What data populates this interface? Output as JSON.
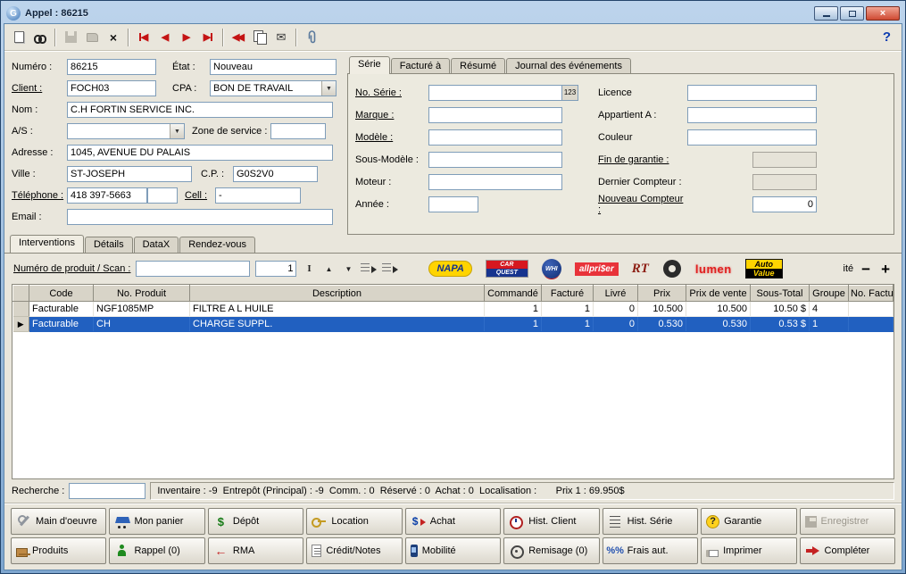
{
  "window": {
    "title": "Appel : 86215"
  },
  "toolbar": {
    "help": "?"
  },
  "form": {
    "numero_label": "Numéro :",
    "numero_value": "86215",
    "etat_label": "État :",
    "etat_value": "Nouveau",
    "client_label": "Client :",
    "client_value": "FOCH03",
    "cpa_label": "CPA :",
    "cpa_value": "BON DE TRAVAIL",
    "nom_label": "Nom :",
    "nom_value": "C.H FORTIN SERVICE INC.",
    "as_label": "A/S :",
    "as_value": "",
    "zone_label": "Zone de service :",
    "zone_value": "",
    "adresse_label": "Adresse :",
    "adresse_value": "1045, AVENUE DU PALAIS",
    "ville_label": "Ville :",
    "ville_value": "ST-JOSEPH",
    "cp_label": "C.P. :",
    "cp_value": "G0S2V0",
    "tel_label": "Téléphone :",
    "tel_value": "418 397-5663",
    "tel_ext_value": "",
    "cell_label": "Cell :",
    "cell_value": "-",
    "email_label": "Email :",
    "email_value": ""
  },
  "serie_panel": {
    "tabs": [
      "Série",
      "Facturé à",
      "Résumé",
      "Journal des événements"
    ],
    "no_serie_label": "No. Série :",
    "no_serie_value": "",
    "badge_123": "123",
    "licence_label": "Licence",
    "licence_value": "",
    "marque_label": "Marque :",
    "marque_value": "",
    "appartient_label": "Appartient A :",
    "appartient_value": "",
    "modele_label": "Modèle :",
    "modele_value": "",
    "couleur_label": "Couleur",
    "couleur_value": "",
    "sousmodele_label": "Sous-Modèle :",
    "sousmodele_value": "",
    "fingarantie_label": "Fin de garantie :",
    "fingarantie_value": "",
    "moteur_label": "Moteur :",
    "moteur_value": "",
    "dernier_label": "Dernier Compteur :",
    "dernier_value": "",
    "annee_label": "Année :",
    "annee_value": "",
    "nouveau_label": "Nouveau Compteur :",
    "nouveau_value": "0"
  },
  "main_tabs": [
    "Interventions",
    "Détails",
    "DataX",
    "Rendez-vous"
  ],
  "scan": {
    "label": "Numéro de produit / Scan :",
    "scan_value": "",
    "qty_value": "1",
    "qty_suffix": "ité",
    "minus": "−",
    "plus": "+"
  },
  "brands": {
    "napa": "NAPA",
    "carquest_top": "CAR",
    "carquest_bottom": "QUEST",
    "whi": "WHI",
    "allpriser": "allpri$er",
    "rt": "RT",
    "lumen": "lumen",
    "autovalue_top": "Auto",
    "autovalue_bottom": "Value"
  },
  "table": {
    "columns": [
      "",
      "Code",
      "No. Produit",
      "Description",
      "Commandé",
      "Facturé",
      "Livré",
      "Prix",
      "Prix de vente",
      "Sous-Total",
      "Groupe",
      "No. Facture"
    ],
    "rows": [
      {
        "marker": "",
        "code": "Facturable",
        "no_produit": "NGF1085MP",
        "description": "FILTRE A L HUILE",
        "commande": "1",
        "facture": "1",
        "livre": "0",
        "prix": "10.500",
        "prix_vente": "10.500",
        "sous_total": "10.50 $",
        "groupe": "4",
        "no_facture": ""
      },
      {
        "marker": "▶",
        "code": "Facturable",
        "no_produit": "CH",
        "description": "CHARGE SUPPL.",
        "commande": "1",
        "facture": "1",
        "livre": "0",
        "prix": "0.530",
        "prix_vente": "0.530",
        "sous_total": "0.53 $",
        "groupe": "1",
        "no_facture": ""
      }
    ]
  },
  "search": {
    "label": "Recherche :",
    "value": ""
  },
  "status": {
    "text": "Inventaire : -9  Entrepôt (Principal) : -9  Comm. : 0  Réservé : 0  Achat : 0  Localisation :       Prix 1 : 69.950$"
  },
  "bottom": {
    "row1": [
      {
        "label": "Main d'oeuvre"
      },
      {
        "label": "Mon panier"
      },
      {
        "label": "Dépôt"
      },
      {
        "label": "Location"
      },
      {
        "label": "Achat"
      },
      {
        "label": "Hist. Client"
      },
      {
        "label": "Hist. Série"
      },
      {
        "label": "Garantie"
      },
      {
        "label": "Enregistrer"
      }
    ],
    "row2": [
      {
        "label": "Produits"
      },
      {
        "label": "Rappel (0)"
      },
      {
        "label": "RMA"
      },
      {
        "label": "Crédit/Notes"
      },
      {
        "label": "Mobilité"
      },
      {
        "label": "Remisage (0)"
      },
      {
        "icon_text": "%%",
        "label": "Frais aut."
      },
      {
        "label": "Imprimer"
      },
      {
        "label": "Compléter"
      }
    ]
  }
}
